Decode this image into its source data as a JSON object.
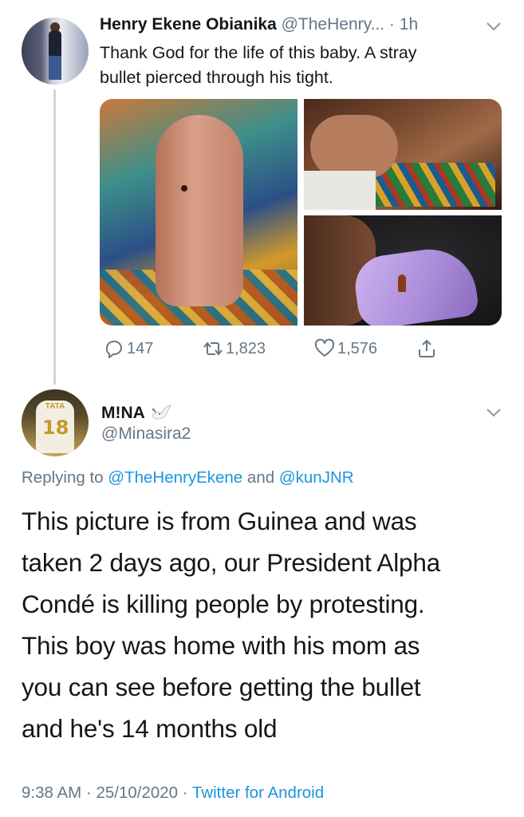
{
  "tweet": {
    "author_name": "Henry Ekene Obianika",
    "author_handle": "@TheHenry...",
    "time_sep": "·",
    "time": "1h",
    "text_line1": "Thank God for the life of this baby. A stray",
    "text_line2": "bullet pierced through his tight.",
    "stats": {
      "replies": "147",
      "retweets": "1,823",
      "likes": "1,576"
    },
    "icons": {
      "reply": "reply-icon",
      "retweet": "retweet-icon",
      "like": "heart-icon",
      "share": "share-icon",
      "more": "chevron-down-icon"
    }
  },
  "reply": {
    "author_name": "M!NA",
    "author_emoji": "dove-icon",
    "author_handle": "@Minasira2",
    "avatar_text": "TATA",
    "avatar_number": "18",
    "replying_prefix": "Replying to",
    "replying_user1": "@TheHenryEkene",
    "replying_and": "and",
    "replying_user2": "@kunJNR",
    "body_lines": [
      "This picture is from Guinea and was",
      "taken 2 days ago, our President Alpha",
      "Condé is killing people by protesting.",
      "This boy was home with his mom as",
      "you can see before getting the bullet",
      "and he's 14 months old"
    ],
    "time": "9:38 AM",
    "sep1": "·",
    "date": "25/10/2020",
    "sep2": "·",
    "source": "Twitter for Android"
  },
  "colors": {
    "text": "#14171a",
    "secondary": "#657786",
    "link": "#1b95e0",
    "thread_line": "#d0d6da"
  }
}
